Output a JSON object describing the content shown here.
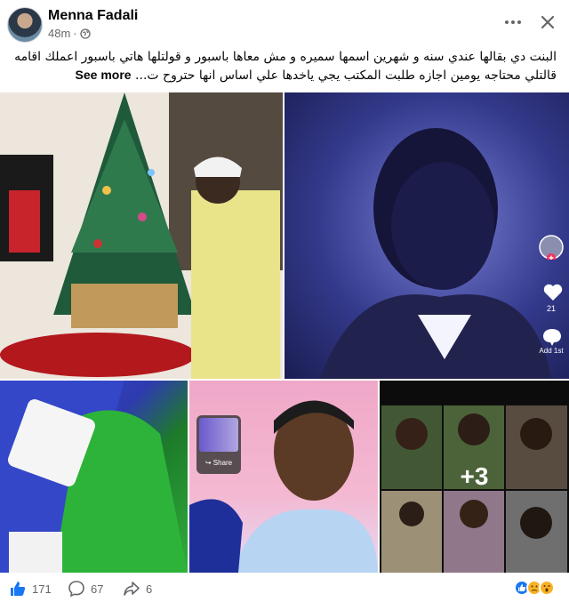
{
  "post": {
    "author": "Menna Fadali",
    "timestamp": "48m",
    "privacy_icon": "globe-icon",
    "text_lines": [
      "البنت دي بقالها عندي سنه و شهرين  اسمها سميره و مش معاها باسبور و قولتلها هاتي باسبور اعملك اقامه",
      "قالتلي محتاجه يومين اجازه طلبت المكتب يجي ياخدها علي اساس انها حتروح ت..."
    ],
    "see_more": "See more"
  },
  "media": {
    "tiktok_like_count": "21",
    "tiktok_add_label": "Add 1st",
    "share_label": "Share",
    "more_count": "+3"
  },
  "footer": {
    "likes": "171",
    "comments": "67",
    "shares": "6",
    "reactions": [
      "like-reaction-icon",
      "sad-reaction-icon",
      "wow-reaction-icon"
    ]
  },
  "colors": {
    "like_blue": "#1877f2",
    "meta_gray": "#65676b",
    "reaction_yellow": "#f7b125"
  }
}
